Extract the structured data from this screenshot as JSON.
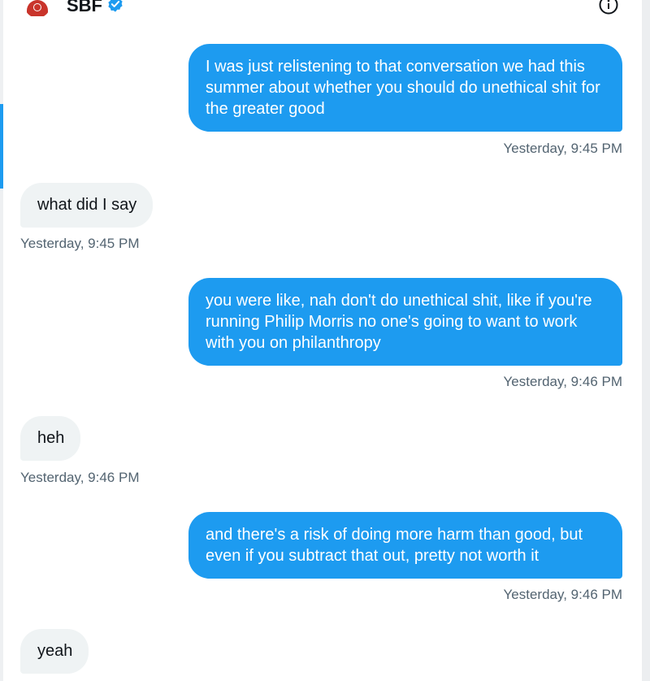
{
  "header": {
    "contact_name": "SBF",
    "avatar_icon": "user-avatar-icon",
    "verified_icon": "verified-badge-icon",
    "info_icon": "info-icon"
  },
  "colors": {
    "sent_bubble": "#1d9bf0",
    "received_bubble": "#eff3f4",
    "timestamp_text": "#536471",
    "verified_badge": "#1d9bf0",
    "avatar_shirt": "#c9342b"
  },
  "messages": [
    {
      "direction": "sent",
      "text": "I was just relistening to that conversation we had this summer about whether you should do unethical shit for the greater good",
      "timestamp": "Yesterday, 9:45 PM"
    },
    {
      "direction": "received",
      "text": "what did I say",
      "timestamp": "Yesterday, 9:45 PM"
    },
    {
      "direction": "sent",
      "text": "you were like, nah don't do unethical shit, like if you're running Philip Morris no one's going to want to work with you on philanthropy",
      "timestamp": "Yesterday, 9:46 PM"
    },
    {
      "direction": "received",
      "text": "heh",
      "timestamp": "Yesterday, 9:46 PM"
    },
    {
      "direction": "sent",
      "text": "and there's a risk of doing more harm than good, but even if you subtract that out, pretty not worth it",
      "timestamp": "Yesterday, 9:46 PM"
    },
    {
      "direction": "received",
      "text": "yeah",
      "timestamp": ""
    }
  ]
}
